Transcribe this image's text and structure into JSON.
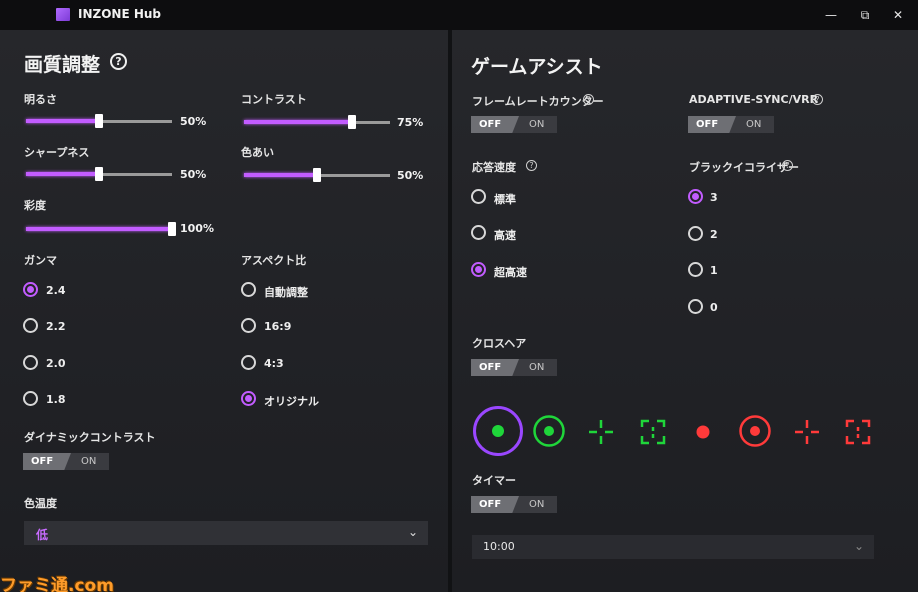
{
  "window": {
    "title": "INZONE Hub",
    "minimize": "—",
    "restore": "⧉",
    "close": "✕"
  },
  "left": {
    "title": "画質調整",
    "help": "?",
    "brightness": {
      "label": "明るさ",
      "value": 0.5,
      "value_text": "50%"
    },
    "contrast": {
      "label": "コントラスト",
      "value": 0.75,
      "value_text": "75%"
    },
    "sharpness": {
      "label": "シャープネス",
      "value": 0.5,
      "value_text": "50%"
    },
    "hue": {
      "label": "色あい",
      "value": 0.5,
      "value_text": "50%"
    },
    "saturation": {
      "label": "彩度",
      "value": 1.0,
      "value_text": "100%"
    },
    "gamma": {
      "label": "ガンマ",
      "selected": 0,
      "options": [
        "2.4",
        "2.2",
        "2.0",
        "1.8"
      ]
    },
    "aspect": {
      "label": "アスペクト比",
      "selected": 3,
      "options": [
        "自動調整",
        "16:9",
        "4:3",
        "オリジナル"
      ]
    },
    "dynamic_contrast": {
      "label": "ダイナミックコントラスト",
      "off": "OFF",
      "on": "ON"
    },
    "color_temp": {
      "label": "色温度",
      "value": "低"
    }
  },
  "right": {
    "title": "ゲームアシスト",
    "frame_rate": {
      "label": "フレームレートカウンター",
      "off": "OFF",
      "on": "ON"
    },
    "adaptive_sync": {
      "label": "ADAPTIVE-SYNC/VRR",
      "off": "OFF",
      "on": "ON"
    },
    "response": {
      "label": "応答速度",
      "selected": 2,
      "options": [
        "標準",
        "高速",
        "超高速"
      ]
    },
    "black_eq": {
      "label": "ブラックイコライザー",
      "selected": 0,
      "options": [
        "3",
        "2",
        "1",
        "0"
      ]
    },
    "crosshair": {
      "label": "クロスヘア",
      "off": "OFF",
      "on": "ON",
      "selected": 0
    },
    "timer": {
      "label": "タイマー",
      "off": "OFF",
      "on": "ON",
      "value": "10:00"
    }
  },
  "colors": {
    "accent": "#c25cff",
    "green": "#1fd63a",
    "red": "#ff3a3a",
    "select_purple": "#c86cff"
  },
  "watermark": "ファミ通.com"
}
